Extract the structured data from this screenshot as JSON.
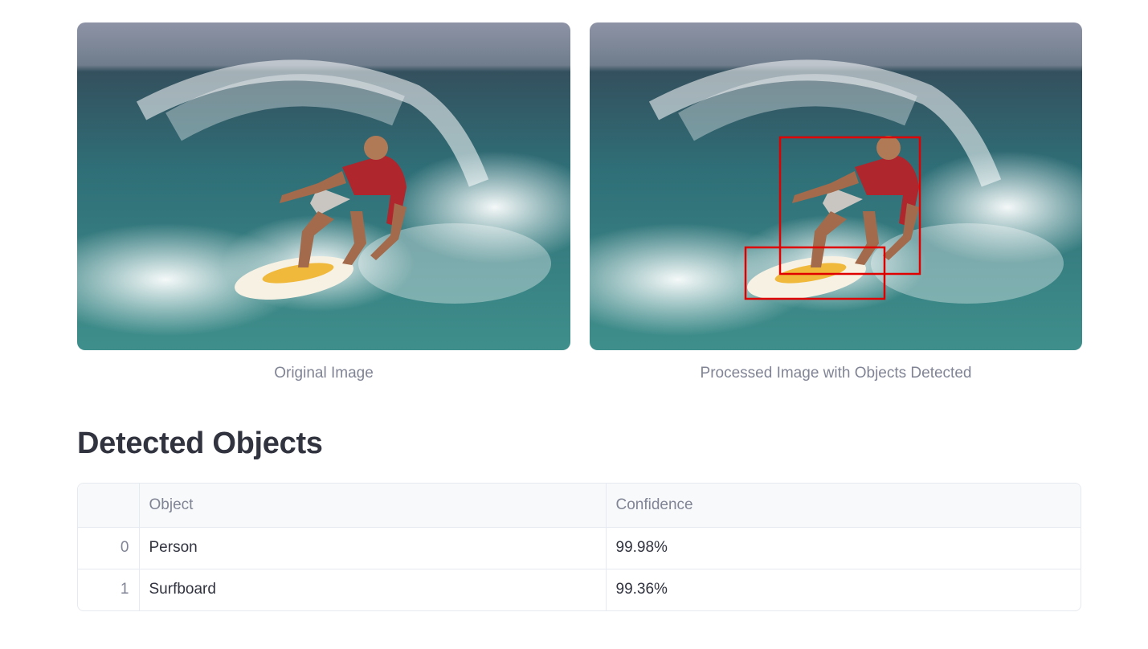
{
  "images": {
    "original_caption": "Original Image",
    "processed_caption": "Processed Image with Objects Detected",
    "detection_box_color": "#e00000"
  },
  "section": {
    "title": "Detected Objects"
  },
  "table": {
    "headers": [
      "",
      "Object",
      "Confidence"
    ],
    "rows": [
      {
        "index": "0",
        "object": "Person",
        "confidence": "99.98%"
      },
      {
        "index": "1",
        "object": "Surfboard",
        "confidence": "99.36%"
      }
    ]
  }
}
